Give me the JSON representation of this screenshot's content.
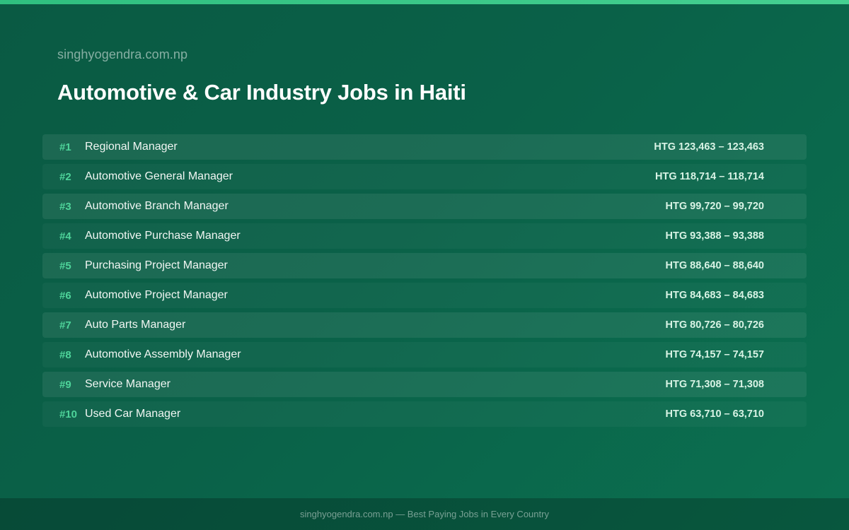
{
  "header": {
    "site_name": "singhyogendra.com.np",
    "title": "Automotive & Car Industry Jobs in Haiti"
  },
  "jobs": [
    {
      "rank": "#1",
      "title": "Regional Manager",
      "salary": "HTG 123,463 – 123,463"
    },
    {
      "rank": "#2",
      "title": "Automotive General Manager",
      "salary": "HTG 118,714 – 118,714"
    },
    {
      "rank": "#3",
      "title": "Automotive Branch Manager",
      "salary": "HTG 99,720 – 99,720"
    },
    {
      "rank": "#4",
      "title": "Automotive Purchase Manager",
      "salary": "HTG 93,388 – 93,388"
    },
    {
      "rank": "#5",
      "title": "Purchasing Project Manager",
      "salary": "HTG 88,640 – 88,640"
    },
    {
      "rank": "#6",
      "title": "Automotive Project Manager",
      "salary": "HTG 84,683 – 84,683"
    },
    {
      "rank": "#7",
      "title": "Auto Parts Manager",
      "salary": "HTG 80,726 – 80,726"
    },
    {
      "rank": "#8",
      "title": "Automotive Assembly Manager",
      "salary": "HTG 74,157 – 74,157"
    },
    {
      "rank": "#9",
      "title": "Service Manager",
      "salary": "HTG 71,308 – 71,308"
    },
    {
      "rank": "#10",
      "title": "Used Car Manager",
      "salary": "HTG 63,710 – 63,710"
    }
  ],
  "footer": {
    "text": "singhyogendra.com.np — Best Paying Jobs in Every Country"
  },
  "colors": {
    "background": "#0a6148",
    "accent": "#4ed49a",
    "top_bar": "#2fbf7f"
  }
}
